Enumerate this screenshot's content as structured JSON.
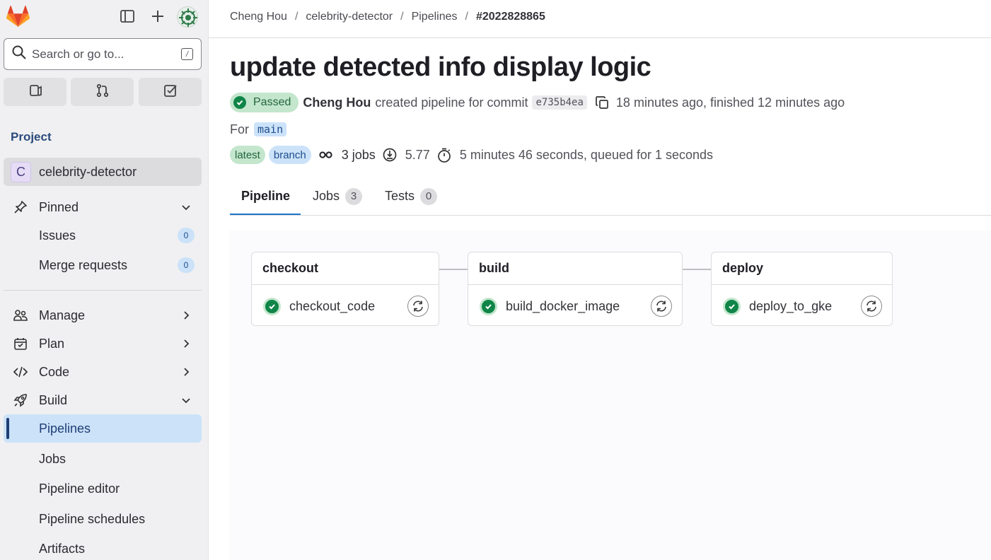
{
  "sidebar": {
    "search_placeholder": "Search or go to...",
    "search_shortcut": "/",
    "section_title": "Project",
    "project": {
      "initial": "C",
      "name": "celebrity-detector"
    },
    "pinned": {
      "label": "Pinned",
      "items": [
        {
          "label": "Issues",
          "count": "0"
        },
        {
          "label": "Merge requests",
          "count": "0"
        }
      ]
    },
    "nav": [
      {
        "label": "Manage",
        "icon": "users-icon"
      },
      {
        "label": "Plan",
        "icon": "calendar-icon"
      },
      {
        "label": "Code",
        "icon": "code-icon"
      },
      {
        "label": "Build",
        "icon": "rocket-icon"
      }
    ],
    "build_items": [
      {
        "label": "Pipelines",
        "active": true
      },
      {
        "label": "Jobs"
      },
      {
        "label": "Pipeline editor"
      },
      {
        "label": "Pipeline schedules"
      },
      {
        "label": "Artifacts"
      }
    ]
  },
  "breadcrumb": [
    "Cheng Hou",
    "celebrity-detector",
    "Pipelines",
    "#2022828865"
  ],
  "pipeline": {
    "title": "update detected info display logic",
    "status": "Passed",
    "author": "Cheng Hou",
    "action_text": "created pipeline for commit",
    "commit_sha": "e735b4ea",
    "timing": "18 minutes ago, finished 12 minutes ago",
    "for_label": "For",
    "ref": "main",
    "badges": [
      "latest",
      "branch"
    ],
    "jobs_count": "3 jobs",
    "compute_minutes": "5.77",
    "duration": "5 minutes 46 seconds, queued for 1 seconds"
  },
  "tabs": [
    {
      "label": "Pipeline",
      "active": true
    },
    {
      "label": "Jobs",
      "count": "3"
    },
    {
      "label": "Tests",
      "count": "0"
    }
  ],
  "stages": [
    {
      "name": "checkout",
      "job": "checkout_code"
    },
    {
      "name": "build",
      "job": "build_docker_image"
    },
    {
      "name": "deploy",
      "job": "deploy_to_gke"
    }
  ],
  "colors": {
    "success": "#108548",
    "accent": "#1f75cb",
    "sidebar_bg": "#f0f0f2"
  }
}
